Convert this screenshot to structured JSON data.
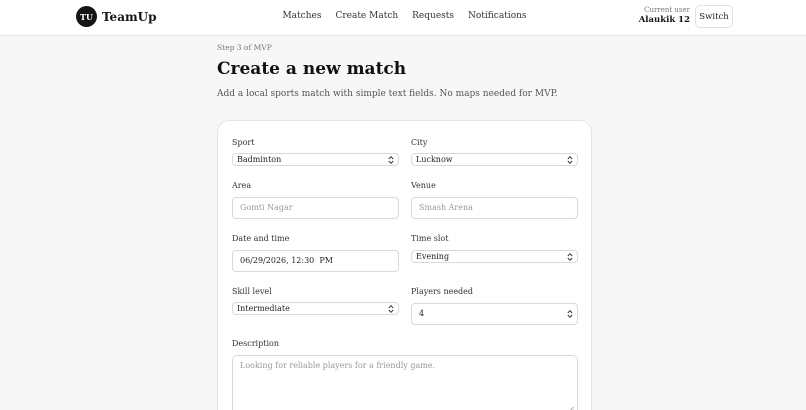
{
  "app": {
    "logo_text": "TU",
    "name": "TeamUp"
  },
  "nav": [
    {
      "label": "Matches"
    },
    {
      "label": "Create Match"
    },
    {
      "label": "Requests"
    },
    {
      "label": "Notifications"
    }
  ],
  "user": {
    "caption": "Current user",
    "name": "Alaukik 12",
    "switch_label": "Switch"
  },
  "page": {
    "step": "Step 3 of MVP",
    "title": "Create a new match",
    "subtitle": "Add a local sports match with simple text fields. No maps needed for MVP."
  },
  "form": {
    "sport": {
      "label": "Sport",
      "value": "Badminton"
    },
    "city": {
      "label": "City",
      "value": "Lucknow"
    },
    "area": {
      "label": "Area",
      "placeholder": "Gomti Nagar"
    },
    "venue": {
      "label": "Venue",
      "placeholder": "Smash Arena"
    },
    "datetime": {
      "label": "Date and time",
      "value": "06/29/2026, 12:30  PM"
    },
    "time_slot": {
      "label": "Time slot",
      "value": "Evening"
    },
    "skill": {
      "label": "Skill level",
      "value": "Intermediate"
    },
    "players": {
      "label": "Players needed",
      "value": "4"
    },
    "description": {
      "label": "Description",
      "placeholder": "Looking for reliable players for a friendly game."
    }
  }
}
